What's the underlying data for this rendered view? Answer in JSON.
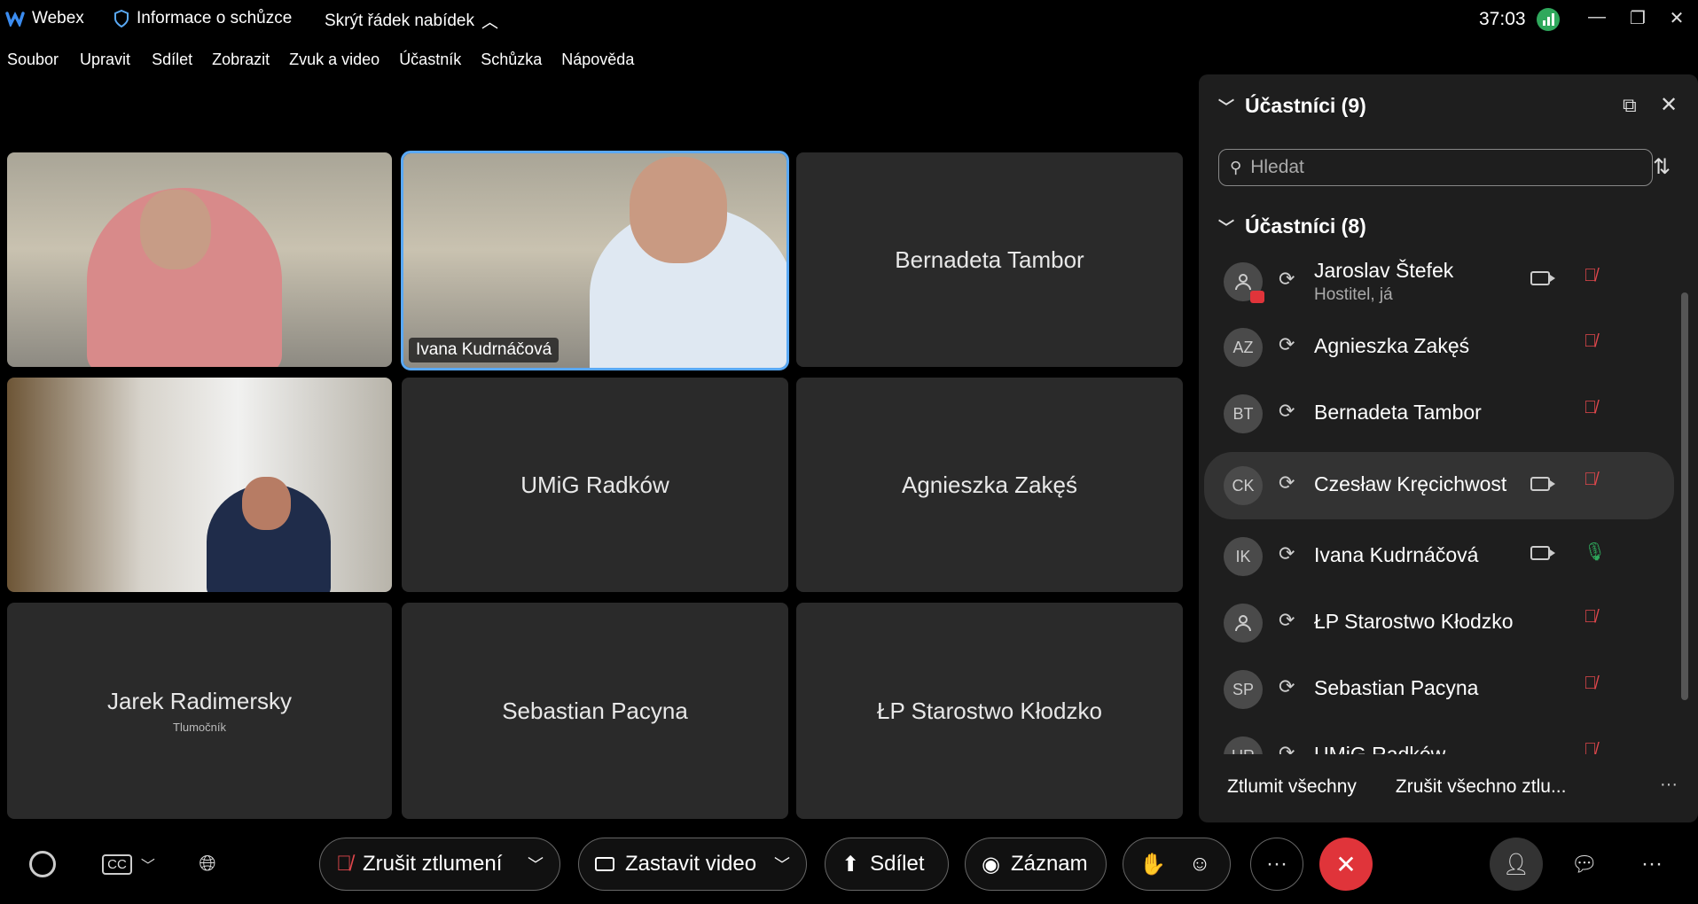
{
  "titlebar": {
    "app_name": "Webex",
    "meeting_info": "Informace o schůzce",
    "hide_menu": "Skrýt řádek nabídek",
    "timer": "37:03"
  },
  "menu": [
    "Soubor",
    "Upravit",
    "Sdílet",
    "Zobrazit",
    "Zvuk a video",
    "Účastník",
    "Schůzka",
    "Nápověda"
  ],
  "grid": {
    "tiles": [
      {
        "name": "",
        "sub": "",
        "video": true
      },
      {
        "name": "Ivana Kudrnáčová",
        "sub": "",
        "video": true
      },
      {
        "name": "Bernadeta Tambor",
        "sub": ""
      },
      {
        "name": "",
        "sub": "",
        "video": true
      },
      {
        "name": "UMiG Radków",
        "sub": ""
      },
      {
        "name": "Agnieszka Zakęś",
        "sub": ""
      },
      {
        "name": "Jarek Radimersky",
        "sub": "Tlumočník"
      },
      {
        "name": "Sebastian Pacyna",
        "sub": ""
      },
      {
        "name": "ŁP Starostwo Kłodzko",
        "sub": ""
      }
    ]
  },
  "panel": {
    "title": "Účastníci (9)",
    "search_placeholder": "Hledat",
    "group_title": "Účastníci (8)",
    "participants": [
      {
        "initials": "",
        "name": "Jaroslav Štefek",
        "role": "Hostitel, já",
        "camera": true,
        "mic": "muted"
      },
      {
        "initials": "AZ",
        "name": "Agnieszka Zakęś",
        "role": "",
        "camera": false,
        "mic": "muted"
      },
      {
        "initials": "BT",
        "name": "Bernadeta Tambor",
        "role": "",
        "camera": false,
        "mic": "muted"
      },
      {
        "initials": "CK",
        "name": "Czesław Kręcichwost",
        "role": "",
        "camera": true,
        "mic": "muted"
      },
      {
        "initials": "IK",
        "name": "Ivana Kudrnáčová",
        "role": "",
        "camera": true,
        "mic": "on"
      },
      {
        "initials": "",
        "name": "ŁP Starostwo Kłodzko",
        "role": "",
        "camera": false,
        "mic": "muted"
      },
      {
        "initials": "SP",
        "name": "Sebastian Pacyna",
        "role": "",
        "camera": false,
        "mic": "muted"
      },
      {
        "initials": "UR",
        "name": "UMiG Radków",
        "role": "",
        "camera": false,
        "mic": "muted"
      }
    ],
    "mute_all": "Ztlumit všechny",
    "unmute_all": "Zrušit všechno ztlu..."
  },
  "bottombar": {
    "unmute": "Zrušit ztlumení",
    "stop_video": "Zastavit video",
    "share": "Sdílet",
    "record": "Záznam"
  },
  "colors": {
    "accent": "#5aa9f5",
    "end_call": "#e0343a",
    "muted": "#e0474c",
    "mic_on": "#2fa85c"
  }
}
